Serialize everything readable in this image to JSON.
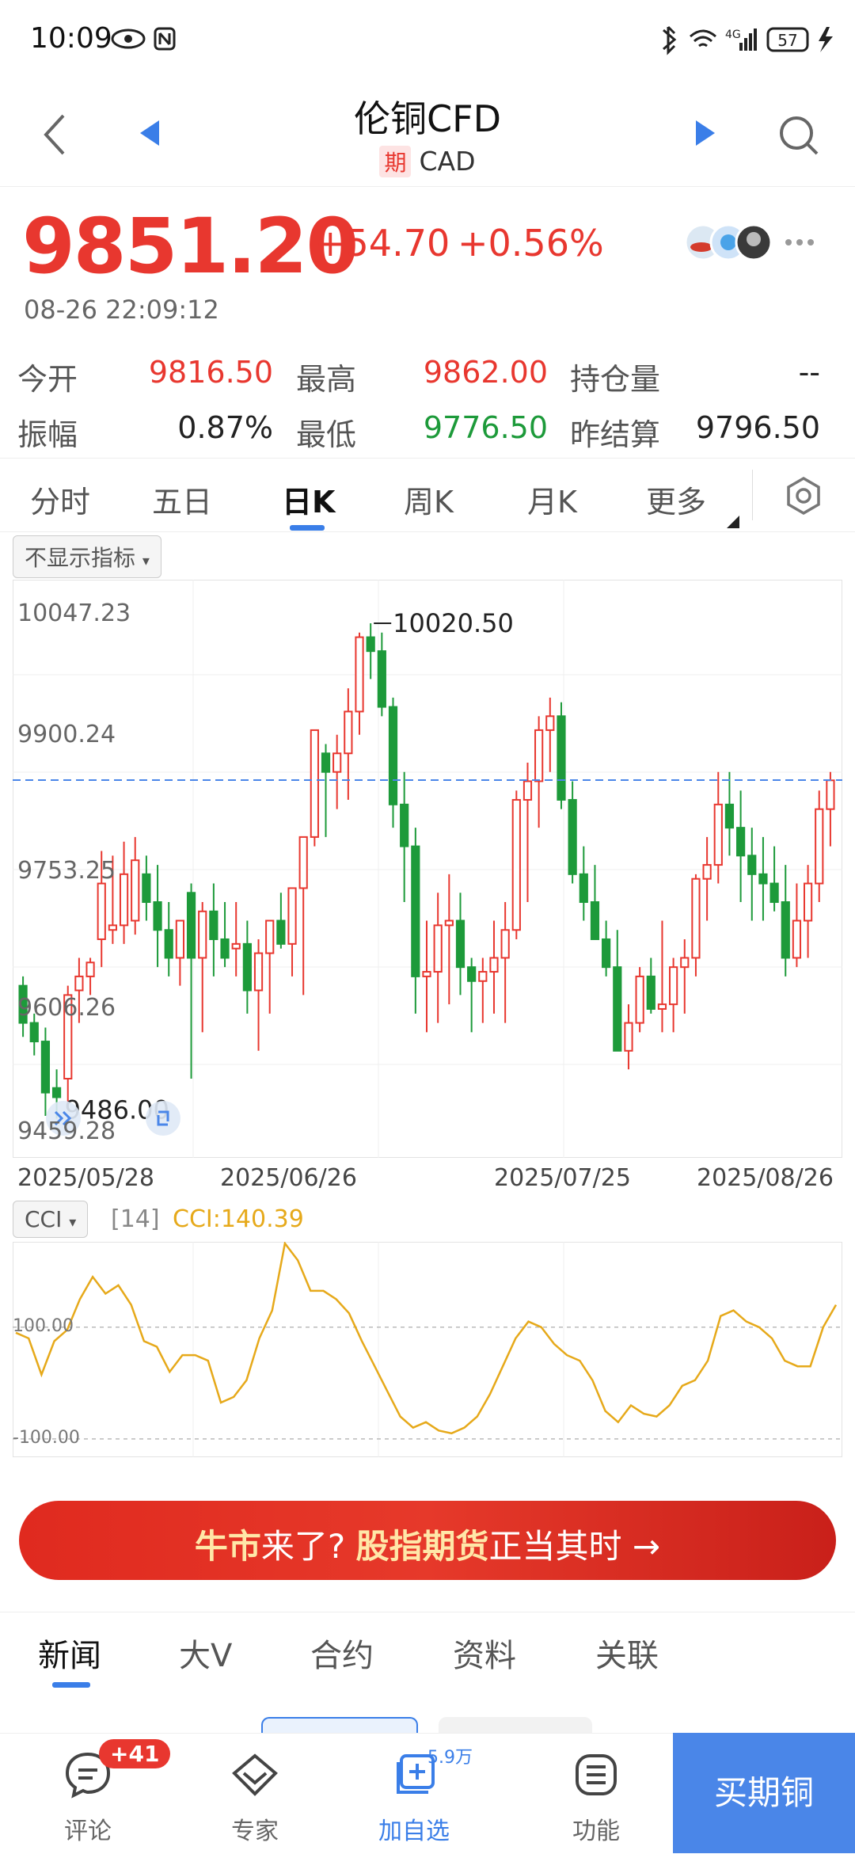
{
  "status_bar": {
    "time": "10:09",
    "battery": "57",
    "network": "4G"
  },
  "header": {
    "title": "伦铜CFD",
    "badge": "期",
    "subtitle": "CAD"
  },
  "quote": {
    "price": "9851.20",
    "change": "+54.70",
    "change_pct": "+0.56%",
    "timestamp": "08-26 22:09:12"
  },
  "stats": [
    {
      "label": "今开",
      "value": "9816.50",
      "color": "#e8372f"
    },
    {
      "label": "最高",
      "value": "9862.00",
      "color": "#e8372f"
    },
    {
      "label": "持仓量",
      "value": "--",
      "color": "#222222"
    },
    {
      "label": "振幅",
      "value": "0.87%",
      "color": "#222222"
    },
    {
      "label": "最低",
      "value": "9776.50",
      "color": "#1d9a3a"
    },
    {
      "label": "昨结算",
      "value": "9796.50",
      "color": "#222222"
    }
  ],
  "ktabs": [
    "分时",
    "五日",
    "日K",
    "周K",
    "月K",
    "更多"
  ],
  "ktab_active": 2,
  "indicator_chip": "不显示指标",
  "cci_chip": "CCI",
  "cci_param": "[14]",
  "cci_value": "CCI:140.39",
  "colors": {
    "up": "#e8372f",
    "down": "#1d9a3a",
    "accent": "#3a7ee8",
    "cci": "#e6a91a"
  },
  "chart_data": [
    {
      "type": "candlestick",
      "y_axis_labels": [
        "10047.23",
        "9900.24",
        "9753.25",
        "9606.26",
        "9459.28"
      ],
      "ylim": [
        9459.28,
        10047.23
      ],
      "x_tick_labels": [
        "2025/05/28",
        "2025/06/26",
        "2025/07/25",
        "2025/08/26"
      ],
      "max_label": "10020.50",
      "min_label": "9486.00",
      "reference_line": 9851.2,
      "candles": [
        [
          9630,
          9640,
          9575,
          9590
        ],
        [
          9590,
          9600,
          9555,
          9570
        ],
        [
          9570,
          9585,
          9490,
          9515
        ],
        [
          9520,
          9540,
          9487,
          9510
        ],
        [
          9530,
          9630,
          9500,
          9620
        ],
        [
          9625,
          9660,
          9590,
          9640
        ],
        [
          9640,
          9660,
          9620,
          9655
        ],
        [
          9680,
          9775,
          9650,
          9740
        ],
        [
          9690,
          9770,
          9675,
          9695
        ],
        [
          9695,
          9785,
          9675,
          9750
        ],
        [
          9700,
          9790,
          9685,
          9765
        ],
        [
          9750,
          9770,
          9700,
          9720
        ],
        [
          9720,
          9760,
          9650,
          9690
        ],
        [
          9690,
          9720,
          9640,
          9660
        ],
        [
          9660,
          9700,
          9630,
          9700
        ],
        [
          9730,
          9740,
          9530,
          9660
        ],
        [
          9660,
          9720,
          9580,
          9710
        ],
        [
          9710,
          9740,
          9640,
          9680
        ],
        [
          9680,
          9720,
          9650,
          9660
        ],
        [
          9670,
          9720,
          9640,
          9675
        ],
        [
          9675,
          9700,
          9600,
          9625
        ],
        [
          9625,
          9680,
          9560,
          9665
        ],
        [
          9665,
          9700,
          9600,
          9700
        ],
        [
          9700,
          9730,
          9670,
          9675
        ],
        [
          9675,
          9730,
          9640,
          9735
        ],
        [
          9735,
          9770,
          9620,
          9790
        ],
        [
          9790,
          9900,
          9780,
          9905
        ],
        [
          9880,
          9890,
          9790,
          9860
        ],
        [
          9860,
          9900,
          9820,
          9880
        ],
        [
          9880,
          9950,
          9830,
          9925
        ],
        [
          9925,
          10010,
          9900,
          10005
        ],
        [
          10005,
          10020,
          9960,
          9990
        ],
        [
          9990,
          10010,
          9920,
          9930
        ],
        [
          9930,
          9940,
          9800,
          9825
        ],
        [
          9825,
          9860,
          9720,
          9780
        ],
        [
          9780,
          9800,
          9600,
          9640
        ],
        [
          9640,
          9700,
          9580,
          9645
        ],
        [
          9645,
          9730,
          9590,
          9695
        ],
        [
          9695,
          9750,
          9610,
          9700
        ],
        [
          9700,
          9730,
          9620,
          9650
        ],
        [
          9650,
          9660,
          9580,
          9635
        ],
        [
          9635,
          9660,
          9590,
          9645
        ],
        [
          9645,
          9700,
          9600,
          9660
        ],
        [
          9660,
          9720,
          9590,
          9690
        ],
        [
          9690,
          9840,
          9680,
          9830
        ],
        [
          9830,
          9870,
          9720,
          9850
        ],
        [
          9850,
          9920,
          9800,
          9905
        ],
        [
          9905,
          9940,
          9860,
          9920
        ],
        [
          9920,
          9935,
          9820,
          9830
        ],
        [
          9830,
          9850,
          9740,
          9750
        ],
        [
          9750,
          9780,
          9700,
          9720
        ],
        [
          9720,
          9760,
          9680,
          9680
        ],
        [
          9680,
          9700,
          9640,
          9650
        ],
        [
          9650,
          9690,
          9560,
          9560
        ],
        [
          9560,
          9610,
          9540,
          9590
        ],
        [
          9590,
          9650,
          9580,
          9640
        ],
        [
          9640,
          9660,
          9600,
          9605
        ],
        [
          9605,
          9700,
          9580,
          9610
        ],
        [
          9610,
          9660,
          9580,
          9650
        ],
        [
          9650,
          9680,
          9600,
          9660
        ],
        [
          9660,
          9750,
          9640,
          9745
        ],
        [
          9745,
          9790,
          9700,
          9760
        ],
        [
          9760,
          9860,
          9740,
          9825
        ],
        [
          9825,
          9860,
          9770,
          9800
        ],
        [
          9800,
          9840,
          9720,
          9770
        ],
        [
          9770,
          9800,
          9700,
          9750
        ],
        [
          9750,
          9790,
          9700,
          9740
        ],
        [
          9740,
          9780,
          9710,
          9720
        ],
        [
          9720,
          9760,
          9640,
          9660
        ],
        [
          9660,
          9740,
          9650,
          9700
        ],
        [
          9700,
          9760,
          9660,
          9740
        ],
        [
          9740,
          9840,
          9720,
          9820
        ],
        [
          9820,
          9860,
          9780,
          9851
        ]
      ]
    },
    {
      "type": "line",
      "name": "CCI",
      "y_axis_labels": [
        "100.00",
        "-100.00"
      ],
      "ylim": [
        -130,
        250
      ],
      "values": [
        90,
        80,
        15,
        75,
        95,
        150,
        190,
        160,
        175,
        140,
        75,
        65,
        20,
        50,
        50,
        40,
        -35,
        -25,
        5,
        80,
        130,
        250,
        220,
        165,
        165,
        150,
        125,
        75,
        30,
        -15,
        -60,
        -80,
        -70,
        -85,
        -90,
        -80,
        -60,
        -20,
        30,
        80,
        110,
        100,
        70,
        50,
        40,
        5,
        -50,
        -70,
        -40,
        -55,
        -60,
        -40,
        -5,
        5,
        40,
        120,
        130,
        110,
        100,
        80,
        40,
        30,
        30,
        100,
        140
      ]
    }
  ],
  "banner": {
    "part1": "牛市",
    "part2": "来了?",
    "part3": "股指期货",
    "part4": "正当其时",
    "arrow": "→"
  },
  "news_tabs": [
    "新闻",
    "大V",
    "合约",
    "资料",
    "关联"
  ],
  "news_tab_active": 0,
  "bottom_nav": {
    "comments": "评论",
    "comments_badge": "+41",
    "experts": "专家",
    "add_watch": "加自选",
    "add_watch_count": "5.9万",
    "functions": "功能",
    "buy": "买期铜"
  }
}
